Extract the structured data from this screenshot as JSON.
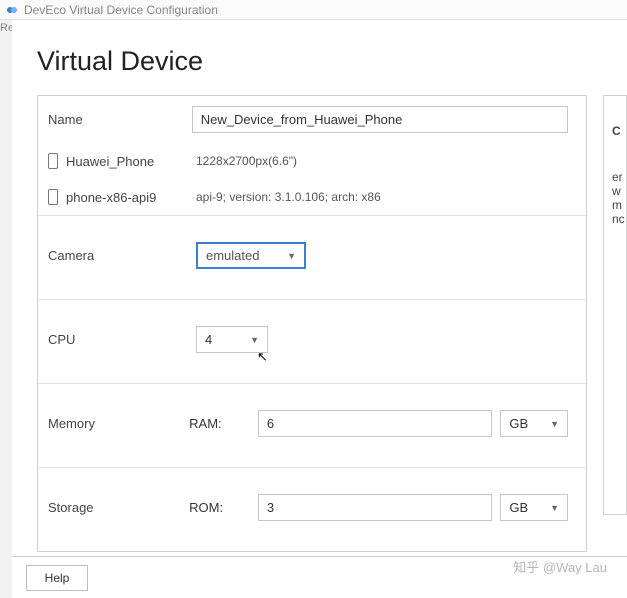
{
  "window": {
    "title": "DevEco Virtual Device Configuration"
  },
  "left_gutter": "Re",
  "page_title": "Virtual Device",
  "form": {
    "name_label": "Name",
    "name_value": "New_Device_from_Huawei_Phone",
    "devices": [
      {
        "name": "Huawei_Phone",
        "desc": "1228x2700px(6.6\")"
      },
      {
        "name": "phone-x86-api9",
        "desc": "api-9; version: 3.1.0.106; arch: x86"
      }
    ],
    "camera_label": "Camera",
    "camera_value": "emulated",
    "cpu_label": "CPU",
    "cpu_value": "4",
    "memory_label": "Memory",
    "memory_sub": "RAM:",
    "memory_value": "6",
    "memory_unit": "GB",
    "storage_label": "Storage",
    "storage_sub": "ROM:",
    "storage_value": "3",
    "storage_unit": "GB"
  },
  "side": {
    "heading": "C",
    "body": "er\nw\nm\nnc"
  },
  "buttons": {
    "help": "Help"
  },
  "watermark": "知乎 @Way Lau"
}
